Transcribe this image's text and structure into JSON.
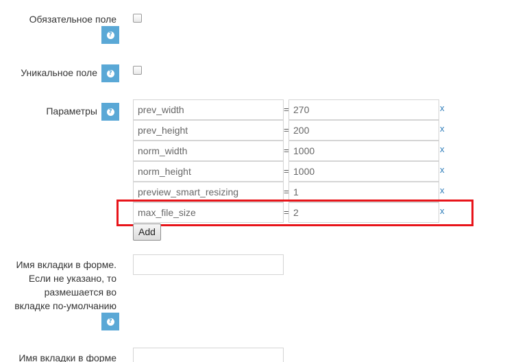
{
  "fields": {
    "required": {
      "label": "Обязательное поле"
    },
    "unique": {
      "label": "Уникальное поле"
    },
    "params": {
      "label": "Параметры",
      "rows": [
        {
          "key": "prev_width",
          "eq": "=",
          "value": "270",
          "remove": "x"
        },
        {
          "key": "prev_height",
          "eq": "=",
          "value": "200",
          "remove": "x"
        },
        {
          "key": "norm_width",
          "eq": "=",
          "value": "1000",
          "remove": "x"
        },
        {
          "key": "norm_height",
          "eq": "=",
          "value": "1000",
          "remove": "x"
        },
        {
          "key": "preview_smart_resizing",
          "eq": "=",
          "value": "1",
          "remove": "x"
        },
        {
          "key": "max_file_size",
          "eq": "=",
          "value": "2",
          "remove": "x"
        }
      ],
      "add_label": "Add"
    },
    "tab_name": {
      "label_lines": [
        "Имя вкладки в форме.",
        "Если не указано, то",
        "размешается во",
        "вкладке по-умолчанию"
      ]
    },
    "tab_name2": {
      "label": "Имя вкладки в форме"
    }
  },
  "icons": {
    "help": "question-mark-icon"
  },
  "colors": {
    "help_bg": "#5aa8d6",
    "highlight": "#e8141a",
    "link": "#2a7ab8"
  }
}
